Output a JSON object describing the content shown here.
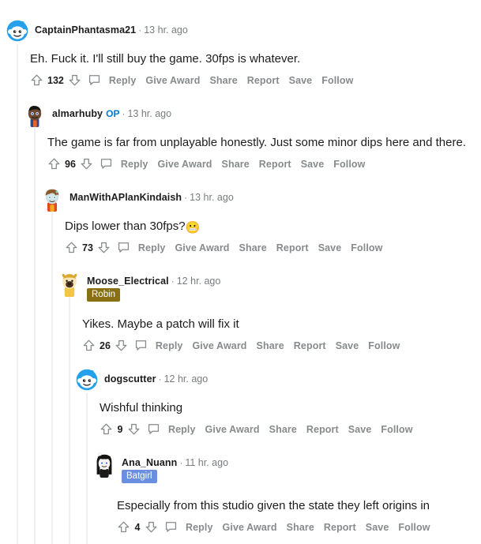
{
  "theme": {
    "accent_blue": "#0079d3",
    "text_primary": "#1c1c1c",
    "text_muted": "#787c7e",
    "action_gray": "#878a8c",
    "threadline": "#edeff1",
    "snoo_blue": "#24a0ed"
  },
  "actions": {
    "upvote_icon": "upvote-arrow-icon",
    "downvote_icon": "downvote-arrow-icon",
    "comment_icon": "comment-bubble-icon",
    "reply": "Reply",
    "give_award": "Give Award",
    "share": "Share",
    "report": "Report",
    "save": "Save",
    "follow": "Follow"
  },
  "separator": "·",
  "comments": [
    {
      "id": "c1",
      "depth": 0,
      "username": "CaptainPhantasma21",
      "op": false,
      "op_label": "",
      "flair": null,
      "timestamp": "13 hr. ago",
      "body": "Eh. Fuck it. I'll still buy the game. 30fps is whatever.",
      "emoji": "",
      "votes": "132",
      "avatar": "snoo-default-avatar"
    },
    {
      "id": "c2",
      "depth": 1,
      "username": "almarhuby",
      "op": true,
      "op_label": "OP",
      "flair": null,
      "timestamp": "13 hr. ago",
      "body": "The game is far from unplayable honestly. Just some minor dips here and there.",
      "emoji": "",
      "votes": "96",
      "avatar": "custom-avatar-almarhuby"
    },
    {
      "id": "c3",
      "depth": 2,
      "username": "ManWithAPlanKindaish",
      "op": false,
      "op_label": "",
      "flair": null,
      "timestamp": "13 hr. ago",
      "body": "Dips lower than 30fps?",
      "emoji": "😬",
      "votes": "73",
      "avatar": "custom-avatar-manwithaplan"
    },
    {
      "id": "c4",
      "depth": 3,
      "username": "Moose_Electrical",
      "op": false,
      "op_label": "",
      "flair": {
        "label": "Robin",
        "bg": "#8a7014",
        "color": "#ffffff"
      },
      "timestamp": "12 hr. ago",
      "body": "Yikes. Maybe a patch will fix it",
      "emoji": "",
      "votes": "26",
      "avatar": "custom-avatar-moose"
    },
    {
      "id": "c5",
      "depth": 4,
      "username": "dogscutter",
      "op": false,
      "op_label": "",
      "flair": null,
      "timestamp": "12 hr. ago",
      "body": "Wishful thinking",
      "emoji": "",
      "votes": "9",
      "avatar": "snoo-default-avatar"
    },
    {
      "id": "c6",
      "depth": 5,
      "username": "Ana_Nuann",
      "op": false,
      "op_label": "",
      "flair": {
        "label": "Batgirl",
        "bg": "#6a8fe0",
        "color": "#ffffff"
      },
      "timestamp": "11 hr. ago",
      "body": "Especially from this studio given the state they left origins in",
      "emoji": "",
      "votes": "4",
      "avatar": "custom-avatar-ana"
    }
  ]
}
